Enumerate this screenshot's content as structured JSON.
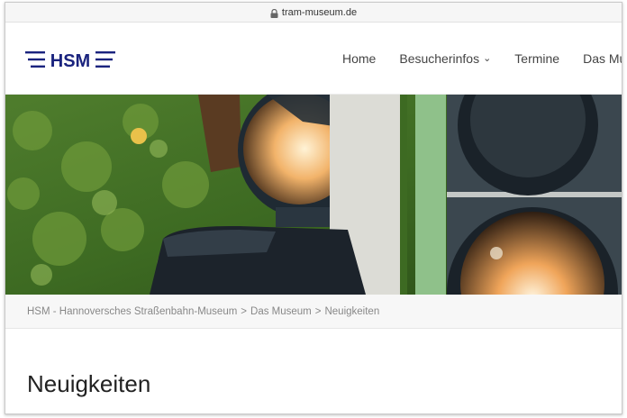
{
  "browser": {
    "url": "tram-museum.de"
  },
  "site": {
    "logo_text": "HSM",
    "brand_color": "#1a237e"
  },
  "nav": {
    "items": [
      {
        "label": "Home"
      },
      {
        "label": "Besucherinfos",
        "has_dropdown": true
      },
      {
        "label": "Termine"
      },
      {
        "label": "Das Museum"
      }
    ]
  },
  "breadcrumb": {
    "items": [
      "HSM - Hannoversches Straßenbahn-Museum",
      "Das Museum",
      "Neuigkeiten"
    ],
    "separator": ">"
  },
  "page": {
    "title": "Neuigkeiten"
  },
  "icons": {
    "lock": "lock-icon",
    "dropdown": "chevron-down-icon"
  }
}
